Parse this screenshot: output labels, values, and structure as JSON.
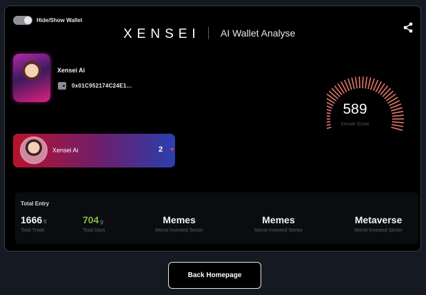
{
  "toggle": {
    "label": "Hide/Show Wallet",
    "on": true
  },
  "header": {
    "brand": "XENSEI",
    "subtitle": "AI Wallet Analyse"
  },
  "profile": {
    "name": "Xensei Ai",
    "wallet_address": "0x01C952174C24E1..."
  },
  "selector": {
    "name": "Xensei Ai",
    "count": "2"
  },
  "score": {
    "value": "589",
    "label": "Xensei Score",
    "fraction": 0.589,
    "color": "#e9786a"
  },
  "stats": {
    "title": "Total Entry",
    "items": [
      {
        "value": "1666",
        "unit": "tt",
        "label": "Total Trade"
      },
      {
        "value": "704",
        "unit": "g",
        "label": "Total Days"
      },
      {
        "value": "Memes",
        "label": "Monst Invested Sector"
      },
      {
        "value": "Memes",
        "label": "Monst Invested Sector"
      },
      {
        "value": "Metaverse",
        "label": "Monst Invested Sector"
      }
    ]
  },
  "footer": {
    "back_label": "Back Homepage"
  },
  "colors": {
    "accent_green": "#7ec23f",
    "gauge_tick": "#e9786a",
    "selector_start": "#b8122c",
    "selector_end": "#2a3fae"
  }
}
